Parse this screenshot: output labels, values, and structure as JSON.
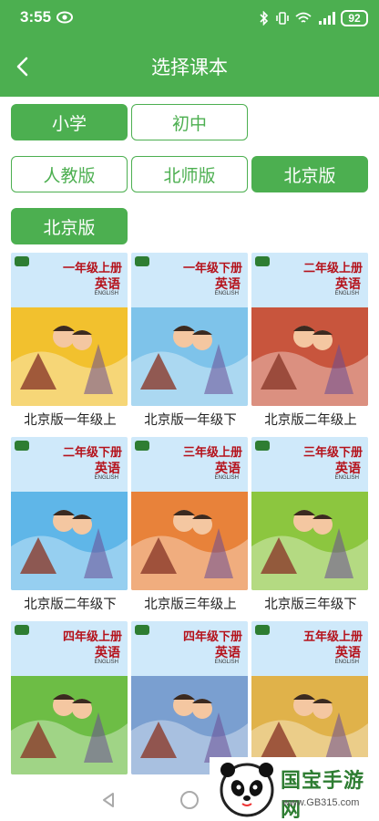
{
  "status_bar": {
    "time": "3:55",
    "battery": "92"
  },
  "app_bar": {
    "title": "选择课本"
  },
  "grades": [
    {
      "label": "小学",
      "selected": true
    },
    {
      "label": "初中",
      "selected": false
    }
  ],
  "publishers": [
    {
      "label": "人教版",
      "selected": false
    },
    {
      "label": "北师版",
      "selected": false
    },
    {
      "label": "北京版",
      "selected": true
    }
  ],
  "edition_tag": {
    "label": "北京版"
  },
  "books": [
    {
      "title": "北京版一年级上",
      "cover_grade": "一年级上册",
      "cover_subject": "英语",
      "cover_en": "ENGLISH",
      "theme": "#f2c12e"
    },
    {
      "title": "北京版一年级下",
      "cover_grade": "一年级下册",
      "cover_subject": "英语",
      "cover_en": "ENGLISH",
      "theme": "#7ec3ea"
    },
    {
      "title": "北京版二年级上",
      "cover_grade": "二年级上册",
      "cover_subject": "英语",
      "cover_en": "ENGLISH",
      "theme": "#c8553d"
    },
    {
      "title": "北京版二年级下",
      "cover_grade": "二年级下册",
      "cover_subject": "英语",
      "cover_en": "ENGLISH",
      "theme": "#5fb6e8"
    },
    {
      "title": "北京版三年级上",
      "cover_grade": "三年级上册",
      "cover_subject": "英语",
      "cover_en": "ENGLISH",
      "theme": "#e8823a"
    },
    {
      "title": "北京版三年级下",
      "cover_grade": "三年级下册",
      "cover_subject": "英语",
      "cover_en": "ENGLISH",
      "theme": "#8cc63f"
    },
    {
      "title": "",
      "cover_grade": "四年级上册",
      "cover_subject": "英语",
      "cover_en": "ENGLISH",
      "theme": "#6dbd45"
    },
    {
      "title": "",
      "cover_grade": "四年级下册",
      "cover_subject": "英语",
      "cover_en": "ENGLISH",
      "theme": "#7a9fd0"
    },
    {
      "title": "",
      "cover_grade": "五年级上册",
      "cover_subject": "英语",
      "cover_en": "ENGLISH",
      "theme": "#e0b24a"
    }
  ],
  "watermark": {
    "title": "国宝手游网",
    "url": "www.GB315.com"
  },
  "colors": {
    "accent": "#4caf50",
    "header_text": "#ffffff"
  },
  "icons": [
    "eye-icon",
    "back-arrow-icon",
    "nav-back-icon",
    "nav-home-icon",
    "panda-logo-icon"
  ]
}
